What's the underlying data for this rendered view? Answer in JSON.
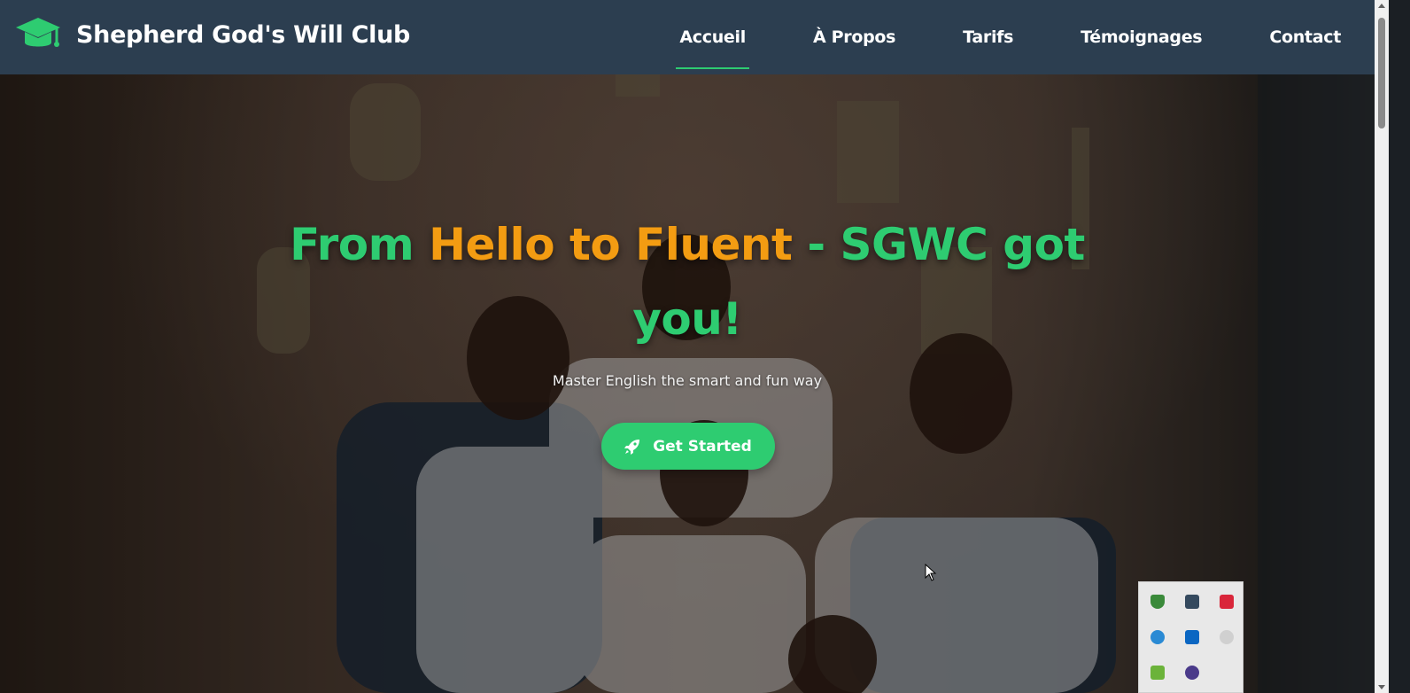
{
  "brand": {
    "name": "Shepherd God's Will Club",
    "logo_icon": "graduation-cap-icon",
    "accent_color": "#2ecc71"
  },
  "nav": {
    "items": [
      {
        "label": "Accueil",
        "active": true
      },
      {
        "label": "À Propos",
        "active": false
      },
      {
        "label": "Tarifs",
        "active": false
      },
      {
        "label": "Témoignages",
        "active": false
      },
      {
        "label": "Contact",
        "active": false
      }
    ],
    "background_color": "#2c3e50"
  },
  "hero": {
    "title_part1": "From ",
    "title_part2": "Hello to Fluent",
    "title_part3": " - SGWC got you!",
    "subtitle": "Master English the smart and fun way",
    "cta_label": "Get Started",
    "cta_icon": "rocket-icon",
    "title_color": "#2ecc71",
    "accent_color": "#f39c12"
  },
  "tray": {
    "icons": [
      {
        "name": "shield-icon",
        "color": "#3a8a3a"
      },
      {
        "name": "remote-desktop-icon",
        "color": "#34495e"
      },
      {
        "name": "pdf-reader-icon",
        "color": "#d9263a"
      },
      {
        "name": "edge-browser-icon",
        "color": "#2a8ad4"
      },
      {
        "name": "linkedin-icon",
        "color": "#0a66c2"
      },
      {
        "name": "skype-icon",
        "color": "#d0d0d0"
      },
      {
        "name": "bluestacks-icon",
        "color": "#6bb33a"
      },
      {
        "name": "app-hexagon-icon",
        "color": "#4a3a8a"
      }
    ]
  }
}
